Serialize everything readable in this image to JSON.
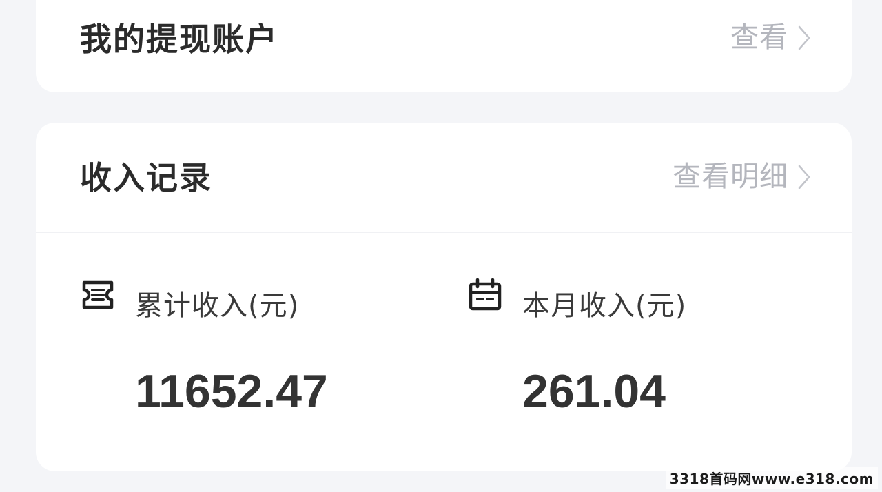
{
  "withdraw_account": {
    "title": "我的提现账户",
    "link_label": "查看"
  },
  "income_record": {
    "title": "收入记录",
    "link_label": "查看明细"
  },
  "stats": {
    "total": {
      "label": "累计收入(元)",
      "value": "11652.47",
      "icon": "ticket-icon"
    },
    "month": {
      "label": "本月收入(元)",
      "value": "261.04",
      "icon": "calendar-icon"
    }
  },
  "watermark": "3318首码网www.e318.com",
  "colors": {
    "background": "#f4f5f8",
    "card": "#ffffff",
    "title_text": "#2b2b2b",
    "link_text": "#b4b6bd",
    "value_text": "#333333"
  }
}
